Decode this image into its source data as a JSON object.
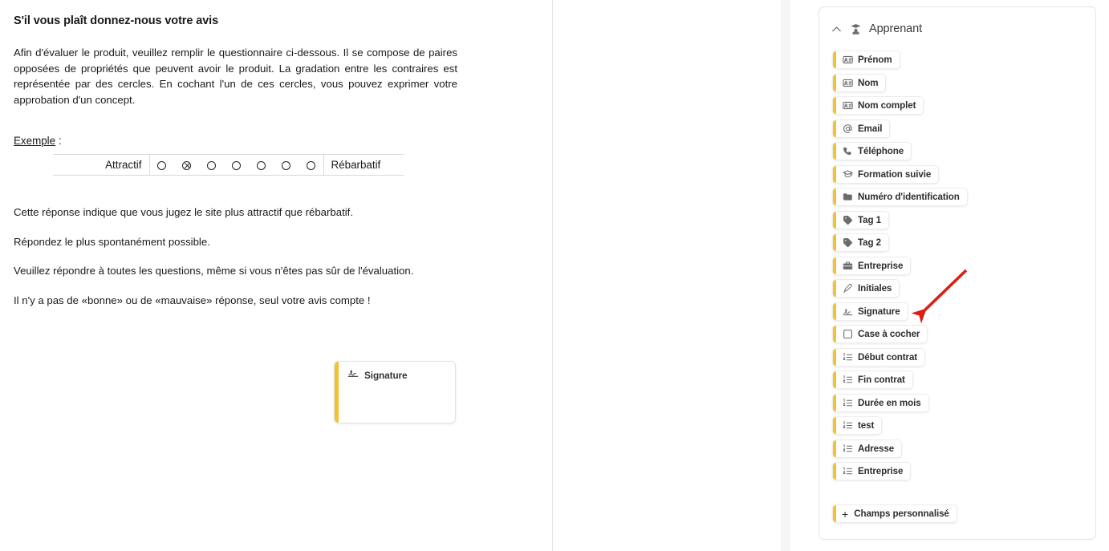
{
  "document": {
    "title": "S'il vous plaît donnez-nous votre avis",
    "intro": "Afin d'évaluer le produit, veuillez remplir le questionnaire ci-dessous. Il se compose de paires opposées de propriétés que peuvent avoir le produit. La gradation entre les contraires est représentée par des cercles. En cochant l'un de ces cercles, vous pouvez exprimer votre approbation d'un concept.",
    "example_label": "Exemple",
    "example_label_suffix": " :",
    "example_table": {
      "left_label": "Attractif",
      "right_label": "Rébarbatif",
      "option_count": 7,
      "checked_index": 1
    },
    "paragraphs": [
      "Cette réponse indique que vous jugez le site plus attractif que rébarbatif.",
      "Répondez le plus spontanément possible.",
      "Veuillez répondre à toutes les questions, même si vous n'êtes pas sûr de l'évaluation.",
      "Il n'y a pas de «bonne» ou de «mauvaise» réponse, seul votre avis compte !"
    ],
    "signature_block": {
      "label": "Signature",
      "icon": "signature-icon",
      "accent_color": "#F2C230"
    }
  },
  "panel": {
    "title": "Apprenant",
    "collapse_icon": "chevron-up-icon",
    "title_icon": "graduate-user-icon",
    "accent_color": "#F2C230",
    "fields": [
      {
        "label": "Prénom",
        "icon": "id-card-icon"
      },
      {
        "label": "Nom",
        "icon": "id-card-icon"
      },
      {
        "label": "Nom complet",
        "icon": "id-card-icon"
      },
      {
        "label": "Email",
        "icon": "at-sign-icon"
      },
      {
        "label": "Téléphone",
        "icon": "phone-icon"
      },
      {
        "label": "Formation suivie",
        "icon": "graduation-cap-icon"
      },
      {
        "label": "Numéro d'identification",
        "icon": "folder-icon"
      },
      {
        "label": "Tag 1",
        "icon": "tag-icon"
      },
      {
        "label": "Tag 2",
        "icon": "tag-icon"
      },
      {
        "label": "Entreprise",
        "icon": "briefcase-icon"
      },
      {
        "label": "Initiales",
        "icon": "pen-icon"
      },
      {
        "label": "Signature",
        "icon": "signature-icon"
      },
      {
        "label": "Case à cocher",
        "icon": "checkbox-icon"
      },
      {
        "label": "Début contrat",
        "icon": "ordered-list-icon"
      },
      {
        "label": "Fin contrat",
        "icon": "ordered-list-icon"
      },
      {
        "label": "Durée en mois",
        "icon": "ordered-list-icon"
      },
      {
        "label": "test",
        "icon": "ordered-list-icon"
      },
      {
        "label": "Adresse",
        "icon": "ordered-list-icon"
      },
      {
        "label": "Entreprise",
        "icon": "ordered-list-icon"
      }
    ],
    "add_button": {
      "label": "Champs personnalisé",
      "prefix": "+"
    }
  },
  "annotation": {
    "arrow_color": "#DA1F13",
    "points_to": "Signature"
  },
  "scrollbar": {
    "thumb_color": "#c1c1c1",
    "track_color": "#f6f6f6"
  }
}
